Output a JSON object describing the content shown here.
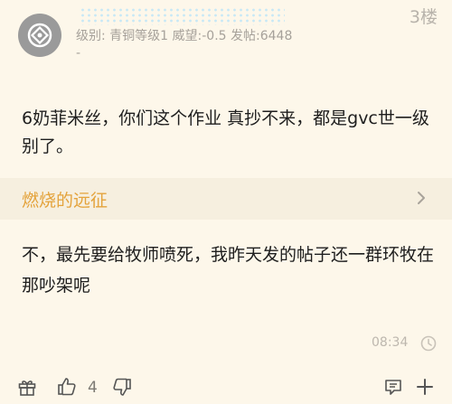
{
  "header": {
    "floor": "3楼",
    "username": "",
    "meta": "级别: 青铜等级1 威望:-0.5 发帖:6448",
    "meta_dash": "-"
  },
  "post": {
    "text": "6奶菲米丝，你们这个作业 真抄不来，都是gvc世一级别了。"
  },
  "quote": {
    "title": "燃烧的远征"
  },
  "reply": {
    "text": "不，最先要给牧师喷死，我昨天发的帖子还一群环牧在那吵架呢"
  },
  "footer": {
    "time": "08:34",
    "like_count": "4"
  },
  "icons": {
    "avatar": "avatar-icon",
    "chevron": "chevron-right-icon",
    "clock": "clock-icon",
    "gift": "gift-icon",
    "like": "thumbs-up-icon",
    "dislike": "thumbs-down-icon",
    "comment": "comment-icon",
    "more": "more-icon"
  },
  "colors": {
    "background": "#fdf7ea",
    "quote_title": "#e4a33c",
    "meta_text": "#a6a19a",
    "body_text": "#1e1e1e"
  }
}
